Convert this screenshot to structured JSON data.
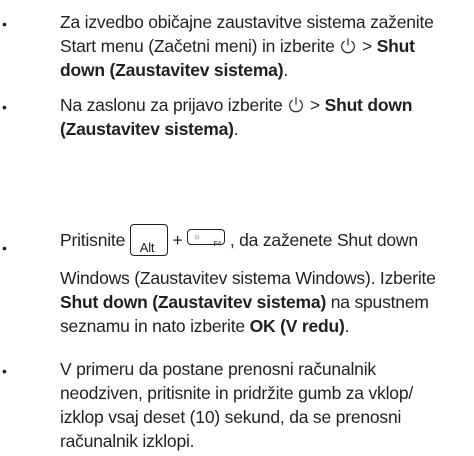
{
  "bullet_glyph": "•",
  "items": [
    {
      "line1": "Za izvedbo običajne zaustavitve sistema zaženite",
      "line2_pre": "Start menu (Začetni meni) in izberite ",
      "line2_sep": " > ",
      "line2_bold": "Shut",
      "line3_bold": "down (Zaustavitev sistema)",
      "line3_tail": "."
    },
    {
      "line1_pre": "Na zaslonu za prijavo izberite ",
      "line1_sep": " > ",
      "line1_bold": "Shut down",
      "line2_bold": "(Zaustavitev sistema)",
      "line2_tail": "."
    },
    {
      "line1_pre": "Pritisnite ",
      "plus": "+",
      "line1_post": ", da zaženete Shut down",
      "alt_key": "Alt",
      "f4_key": "F4",
      "line2": "Windows (Zaustavitev sistema Windows). Izberite",
      "line3_bold": "Shut down (Zaustavitev sistema)",
      "line3_tail": " na spustnem",
      "line4_pre": "seznamu in nato izberite ",
      "line4_bold": "OK (V redu)",
      "line4_tail": "."
    },
    {
      "line1": "V primeru da postane prenosni računalnik",
      "line2": "neodziven, pritisnite in pridržite gumb za vklop/",
      "line3": "izklop vsaj deset (10) sekund, da se prenosni",
      "line4": "računalnik izklopi."
    }
  ],
  "icons": {
    "power": "power-icon",
    "sun": "brightness-icon"
  }
}
